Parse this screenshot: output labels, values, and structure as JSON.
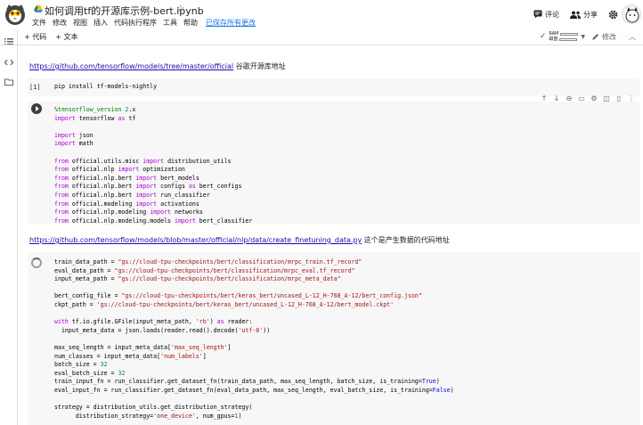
{
  "header": {
    "title": "如何调用tf的开源库示例-bert.ipynb",
    "menu": [
      "文件",
      "修改",
      "视图",
      "插入",
      "代码执行程序",
      "工具",
      "帮助"
    ],
    "saved_status": "已保存所有更改",
    "comment_label": "评论",
    "share_label": "分享"
  },
  "toolbar": {
    "add_code": "+ 代码",
    "add_text": "+ 文本",
    "ram_label": "RAM",
    "disk_label": "磁盘",
    "edit_label": "修改"
  },
  "cells": {
    "text1": {
      "link": "https://github.com/tensorflow/models/tree/master/official",
      "suffix": " 谷歌开源库地址"
    },
    "cell1": {
      "exec": "[1]",
      "code": "pip install tf-models-nightly"
    },
    "text2": {
      "link": "https://github.com/tensorflow/models/blob/master/official/nlp/data/create_finetuning_data.py",
      "suffix": " 这个是产生数据的代码地址"
    }
  },
  "colors": {
    "link": "#1a0dab",
    "keyword": "#af00db",
    "string": "#a31515",
    "magic": "#008000",
    "saved": "#1a73e8"
  }
}
